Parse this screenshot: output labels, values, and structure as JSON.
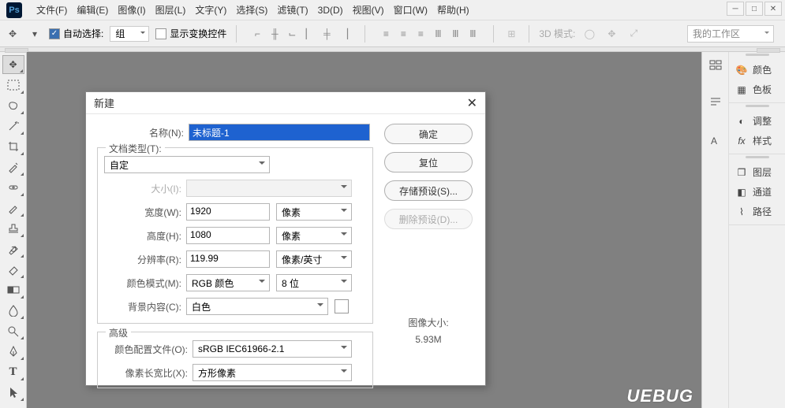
{
  "menubar": {
    "items": [
      "文件(F)",
      "编辑(E)",
      "图像(I)",
      "图层(L)",
      "文字(Y)",
      "选择(S)",
      "滤镜(T)",
      "3D(D)",
      "视图(V)",
      "窗口(W)",
      "帮助(H)"
    ]
  },
  "optionsbar": {
    "auto_select_label": "自动选择:",
    "group_label": "组",
    "show_transform_label": "显示变换控件",
    "mode3d_label": "3D 模式:",
    "workspace_label": "我的工作区"
  },
  "right_panels": {
    "color": "颜色",
    "swatches": "色板",
    "adjustments": "调整",
    "styles": "样式",
    "layers": "图层",
    "channels": "通道",
    "paths": "路径"
  },
  "dialog": {
    "title": "新建",
    "labels": {
      "name": "名称(N):",
      "doc_type": "文档类型(T):",
      "size": "大小(I):",
      "width": "宽度(W):",
      "height": "高度(H):",
      "resolution": "分辨率(R):",
      "color_mode": "颜色模式(M):",
      "background": "背景内容(C):",
      "advanced": "高级",
      "color_profile": "颜色配置文件(O):",
      "pixel_aspect": "像素长宽比(X):",
      "image_size": "图像大小:"
    },
    "values": {
      "name": "未标题-1",
      "doc_type": "自定",
      "size": "",
      "width": "1920",
      "height": "1080",
      "resolution": "119.99",
      "color_mode": "RGB 颜色",
      "bit_depth": "8 位",
      "background": "白色",
      "color_profile": "sRGB IEC61966-2.1",
      "pixel_aspect": "方形像素",
      "image_size": "5.93M"
    },
    "units": {
      "pixels": "像素",
      "ppi": "像素/英寸"
    },
    "buttons": {
      "ok": "确定",
      "reset": "复位",
      "save_preset": "存储预设(S)...",
      "delete_preset": "删除预设(D)..."
    }
  },
  "watermark": "UEBUG"
}
